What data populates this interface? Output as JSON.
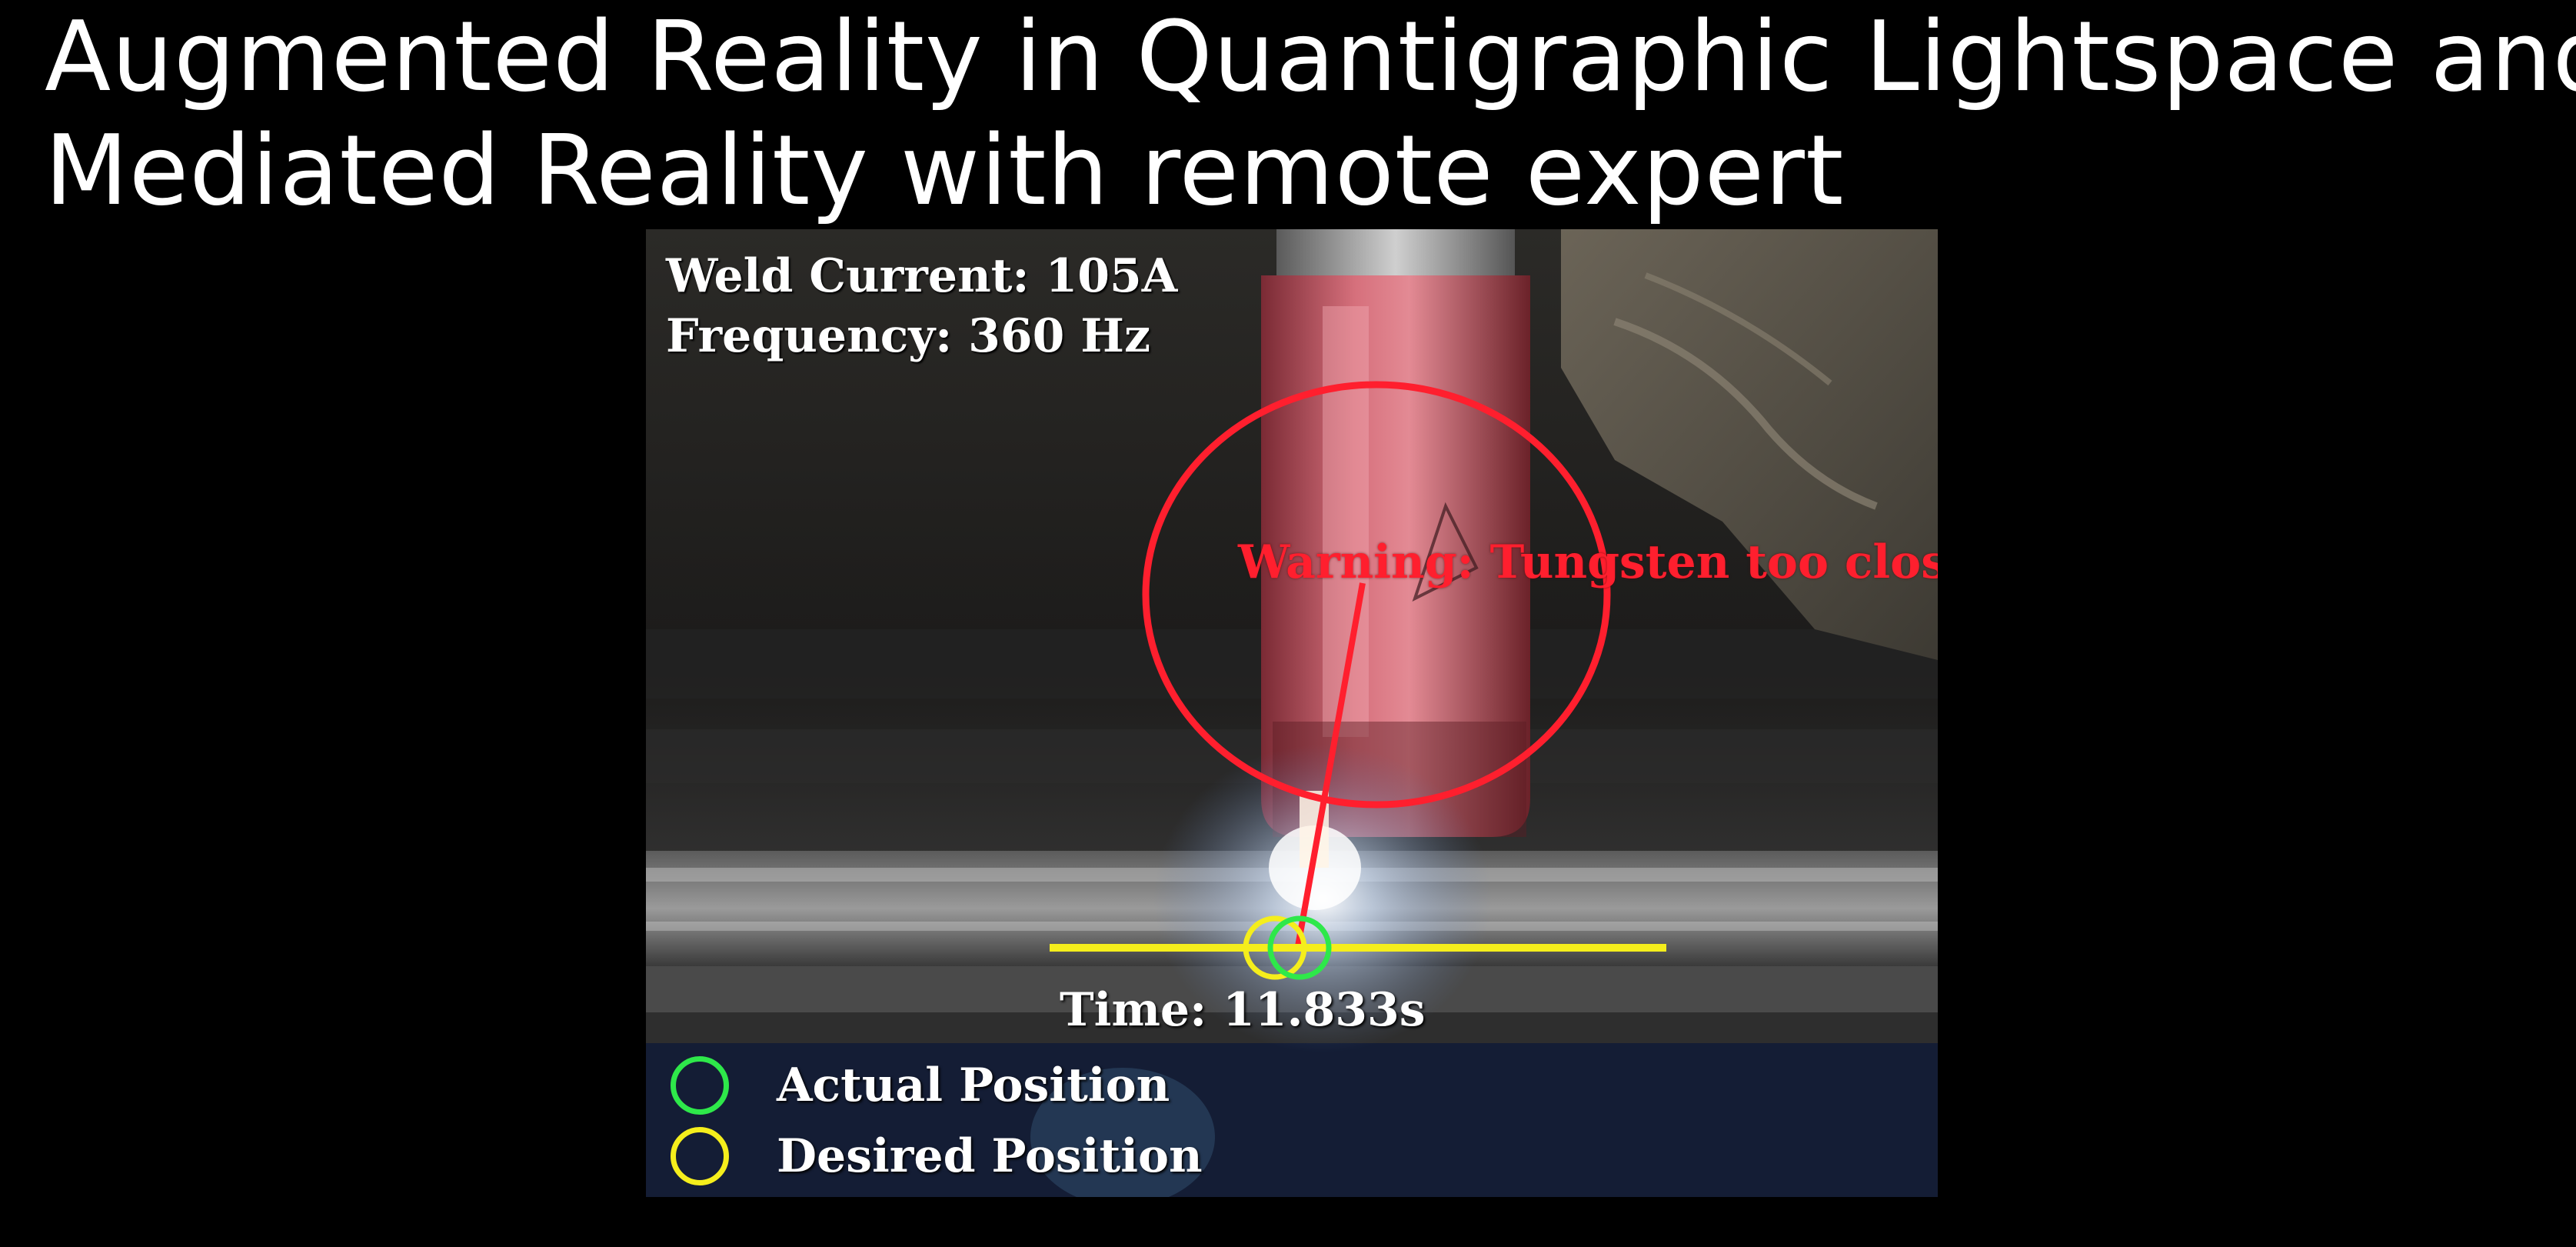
{
  "slide": {
    "title_line1": "Augmented Reality in Quantigraphic Lightspace and",
    "title_line2": "Mediated Reality with remote expert"
  },
  "video": {
    "weld_current": "Weld Current: 105A",
    "frequency": "Frequency: 360 Hz",
    "warning": "Warning: Tungsten too close!",
    "timer": "Time: 11.833s",
    "legend": [
      {
        "label": "Actual Position",
        "color": "#2ee84a"
      },
      {
        "label": "Desired Position",
        "color": "#f5ee1c"
      }
    ]
  },
  "colors": {
    "warning": "#ff1f2e",
    "guide_line": "#f5ee1c",
    "actual": "#2ee84a",
    "desired": "#f5ee1c"
  }
}
